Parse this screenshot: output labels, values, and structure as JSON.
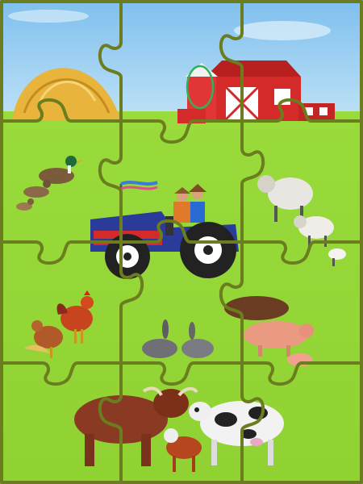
{
  "puzzle": {
    "rows": 4,
    "cols": 3,
    "colors": {
      "sky": "#8fc6ee",
      "grass": "#98d83a",
      "piece_border": "#6b7d1e",
      "barn_red": "#d42a2a",
      "hay": "#e8b43c",
      "tractor_blue": "#2a3b9a",
      "highlight_ring": "#2fb35a"
    },
    "pieces": [
      {
        "row": 0,
        "col": 0,
        "subject": "haystack"
      },
      {
        "row": 0,
        "col": 1,
        "subject": "sky-barn-roof"
      },
      {
        "row": 0,
        "col": 2,
        "subject": "barn"
      },
      {
        "row": 1,
        "col": 0,
        "subject": "ducks"
      },
      {
        "row": 1,
        "col": 1,
        "subject": "tractor-top"
      },
      {
        "row": 1,
        "col": 2,
        "subject": "sheep"
      },
      {
        "row": 2,
        "col": 0,
        "subject": "rooster-hen"
      },
      {
        "row": 2,
        "col": 1,
        "subject": "rabbits"
      },
      {
        "row": 2,
        "col": 2,
        "subject": "pigs"
      },
      {
        "row": 3,
        "col": 0,
        "subject": "bull-left"
      },
      {
        "row": 3,
        "col": 1,
        "subject": "bull-calf"
      },
      {
        "row": 3,
        "col": 2,
        "subject": "cow"
      }
    ]
  }
}
